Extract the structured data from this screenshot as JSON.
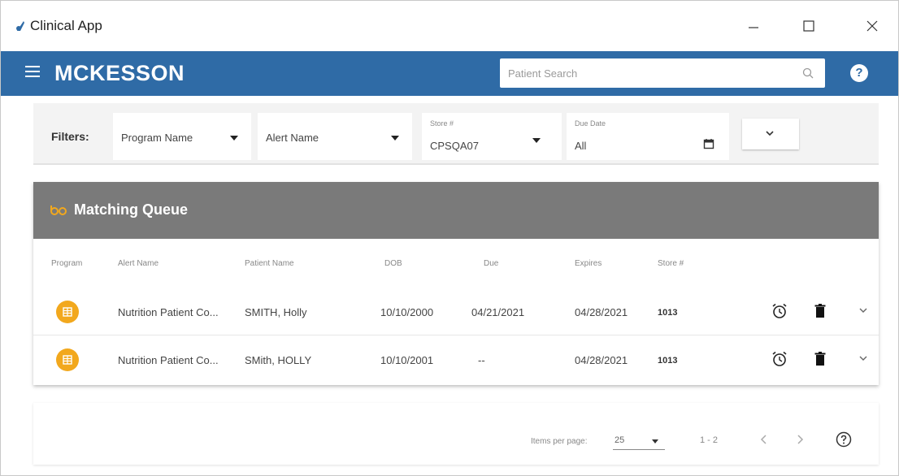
{
  "window": {
    "title": "Clinical App"
  },
  "header": {
    "logo": "MCKESSON",
    "search_placeholder": "Patient Search"
  },
  "filters": {
    "label": "Filters:",
    "program_name": {
      "value": "Program Name"
    },
    "alert_name": {
      "value": "Alert Name"
    },
    "store": {
      "label": "Store #",
      "value": "CPSQA07"
    },
    "due_date": {
      "label": "Due Date",
      "value": "All"
    }
  },
  "queue": {
    "title": "Matching Queue",
    "columns": [
      "Program",
      "Alert Name",
      "Patient Name",
      "DOB",
      "Due",
      "Expires",
      "Store #"
    ],
    "rows": [
      {
        "alert": "Nutrition Patient Co...",
        "patient": "SMITH, Holly",
        "dob": "10/10/2000",
        "due": "04/21/2021",
        "expires": "04/28/2021",
        "store": "1013"
      },
      {
        "alert": "Nutrition Patient Co...",
        "patient": "SMith, HOLLY",
        "dob": "10/10/2001",
        "due": "--",
        "expires": "04/28/2021",
        "store": "1013"
      }
    ]
  },
  "paginator": {
    "items_per_page_label": "Items per page:",
    "items_per_page": "25",
    "range": "1 - 2"
  },
  "colors": {
    "header_blue": "#2f6ba6",
    "card_header_gray": "#7a7a7a",
    "program_icon_orange": "#f2a81d"
  },
  "icons": [
    "app-icon",
    "hamburger-icon",
    "search-icon",
    "help-icon",
    "calendar-icon",
    "chevron-down-icon",
    "queue-icon",
    "program-icon",
    "alarm-icon",
    "trash-icon",
    "chevron-left-icon",
    "chevron-right-icon"
  ]
}
